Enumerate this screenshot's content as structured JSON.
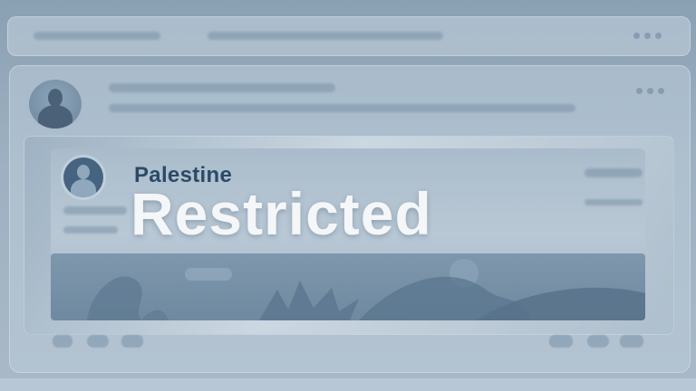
{
  "post": {
    "page_name": "Palestine",
    "status_label": "Restricted"
  },
  "icons": {
    "menu": "more-dots-icon",
    "avatar": "user-avatar-icon",
    "like": "like-icon",
    "comment": "comment-icon",
    "share": "share-icon"
  },
  "colors": {
    "background": "#9db0c1",
    "page_name_text": "#2c4a66",
    "status_text": "#f4f6f8",
    "media_fill": "#7e97ad"
  }
}
